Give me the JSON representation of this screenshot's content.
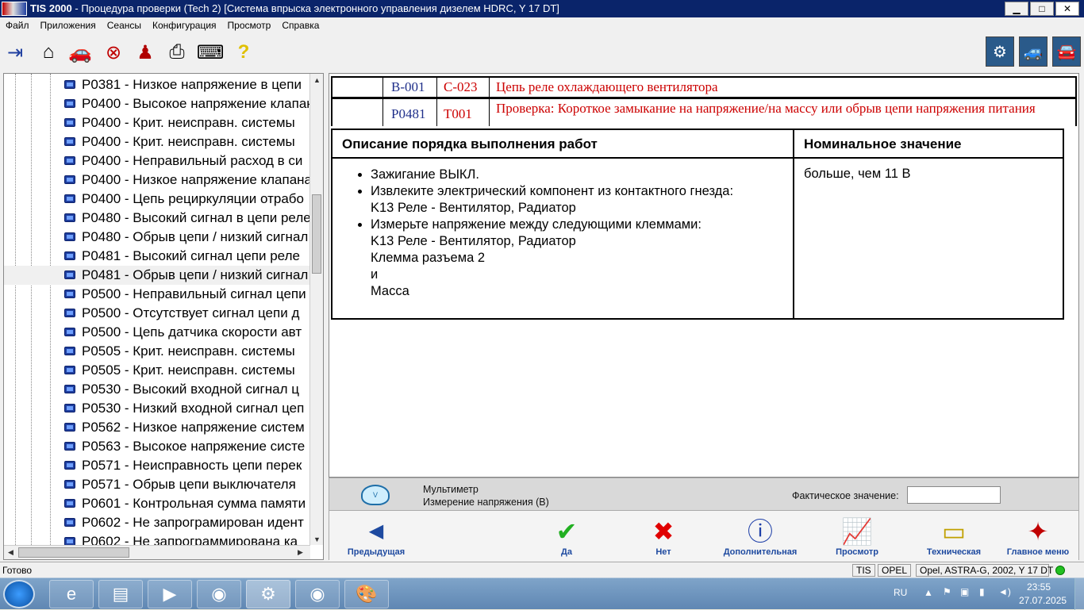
{
  "window": {
    "app_name": "TIS 2000",
    "title_rest": " - Процедура проверки (Tech 2) [Система впрыска электронного управления дизелем HDRC, Y 17 DT]",
    "btn_min": "▁",
    "btn_max": "□",
    "btn_close": "✕"
  },
  "menu": [
    "Файл",
    "Приложения",
    "Сеансы",
    "Конфигурация",
    "Просмотр",
    "Справка"
  ],
  "toolbar": {
    "icons": [
      "exit-icon",
      "home-icon",
      "vehicle-icon",
      "stop-icon",
      "person-icon",
      "print-icon",
      "keyboard-icon",
      "help-icon"
    ],
    "right_icons": [
      "diagnostics-icon",
      "vehicle-data-icon",
      "vehicle-service-icon"
    ]
  },
  "tree": {
    "items": [
      "P0381 - Низкое напряжение в цепи",
      "P0400 - Высокое напряжение клапана",
      "P0400 - Крит. неисправн. системы",
      "P0400 - Крит. неисправн. системы",
      "P0400 - Неправильный расход в си",
      "P0400 - Низкое напряжение клапана",
      "P0400 - Цепь рециркуляции отрабо",
      "P0480 - Высокий сигнал в цепи реле",
      "P0480 - Обрыв цепи / низкий сигнал",
      "P0481 - Высокий сигнал цепи реле",
      "P0481 - Обрыв цепи / низкий сигнал",
      "P0500 - Неправильный сигнал цепи",
      "P0500 - Отсутствует сигнал цепи д",
      "P0500 - Цепь датчика скорости авт",
      "P0505 - Крит. неисправн. системы",
      "P0505 - Крит. неисправн. системы",
      "P0530 - Высокий входной сигнал ц",
      "P0530 - Низкий входной сигнал цеп",
      "P0562 - Низкое напряжение систем",
      "P0563 - Высокое напряжение систе",
      "P0571 - Неисправность цепи перек",
      "P0571 - Обрыв цепи выключателя",
      "P0601 - Контрольная сумма памяти",
      "P0602 - Не запрограмирован идент",
      "P0602 - Не запрограммирована ка"
    ],
    "selected_index": 10
  },
  "codes": [
    {
      "code": "B-001",
      "ref": "C-023",
      "desc": "Цепь реле охлаждающего вентилятора"
    },
    {
      "code": "P0481",
      "ref": "T001",
      "desc": "Проверка: Короткое замыкание на напряжение/на массу или обрыв цепи напряжения питания"
    }
  ],
  "procedure": {
    "col1_header": "Описание порядка выполнения работ",
    "col2_header": "Номинальное значение",
    "steps": [
      {
        "lines": [
          "Зажигание ВЫКЛ."
        ]
      },
      {
        "lines": [
          "Извлеките электрический компонент из контактного гнезда:",
          "K13 Реле - Вентилятор, Радиатор"
        ]
      },
      {
        "lines": [
          "Измерьте напряжение между следующими клеммами:",
          "K13 Реле - Вентилятор, Радиатор",
          "Клемма разъема 2",
          "и",
          "Масса"
        ]
      }
    ],
    "nominal": "больше, чем 11 В"
  },
  "measurement": {
    "instrument": "Мультиметр",
    "mode": "Измерение напряжения (В)",
    "actual_label": "Фактическое значение:",
    "actual_value": ""
  },
  "nav": [
    {
      "icon": "back-arrow-icon",
      "label": "Предыдущая"
    },
    {
      "icon": "checkmark-icon",
      "label": "Да"
    },
    {
      "icon": "cross-icon",
      "label": "Нет"
    },
    {
      "icon": "info-icon",
      "label": "Дополнительная"
    },
    {
      "icon": "chart-icon",
      "label": "Просмотр"
    },
    {
      "icon": "document-icon",
      "label": "Техническая"
    },
    {
      "icon": "main-menu-icon",
      "label": "Главное меню"
    }
  ],
  "status": {
    "ready": "Готово",
    "tis": "TIS",
    "brand": "OPEL",
    "vehicle": "Opel, ASTRA-G, 2002, Y 17 DT"
  },
  "taskbar": {
    "lang": "RU",
    "time": "23:55",
    "date": "27.07.2025"
  },
  "colors": {
    "title_bg": "#0a246a",
    "code_blue": "#1f2f8a",
    "code_red": "#cc0000",
    "link_blue": "#1e4aa0"
  }
}
